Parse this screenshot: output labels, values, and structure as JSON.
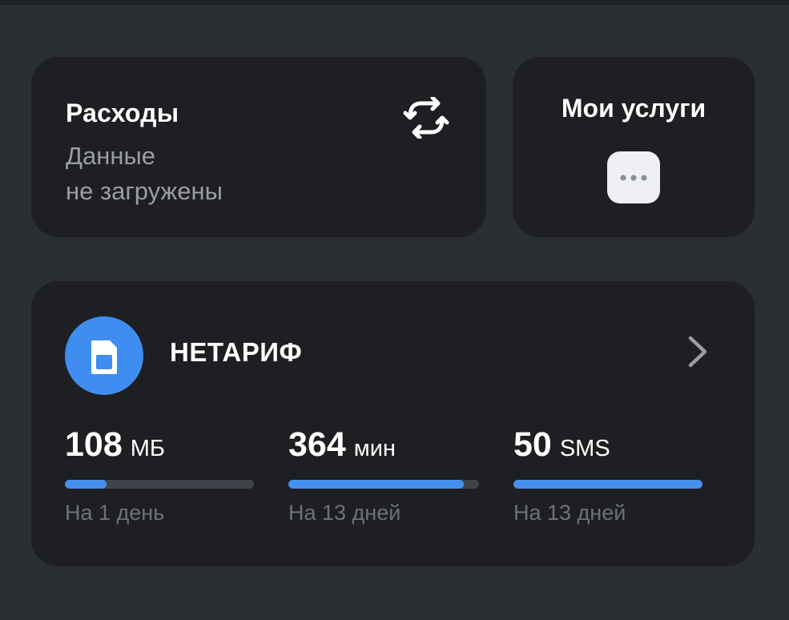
{
  "expenses": {
    "title": "Расходы",
    "status_line1": "Данные",
    "status_line2": "не загружены",
    "refresh_icon": "refresh-icon"
  },
  "services": {
    "title": "Мои услуги",
    "more_icon": "more-dots-icon"
  },
  "tariff": {
    "name": "НЕТАРИФ",
    "sim_icon": "sim-card-icon",
    "chevron_icon": "chevron-right-icon",
    "sim_color": "#3f8df0",
    "stats": [
      {
        "value": "108",
        "unit": "МБ",
        "period": "На 1 день",
        "fill": 0.22
      },
      {
        "value": "364",
        "unit": "мин",
        "period": "На 13 дней",
        "fill": 0.92
      },
      {
        "value": "50",
        "unit": "SMS",
        "period": "На 13 дней",
        "fill": 1.0
      }
    ]
  },
  "colors": {
    "background": "#2b2e33",
    "card": "#1d1f22",
    "accent": "#4590ef",
    "muted_text": "#9a9da2"
  }
}
